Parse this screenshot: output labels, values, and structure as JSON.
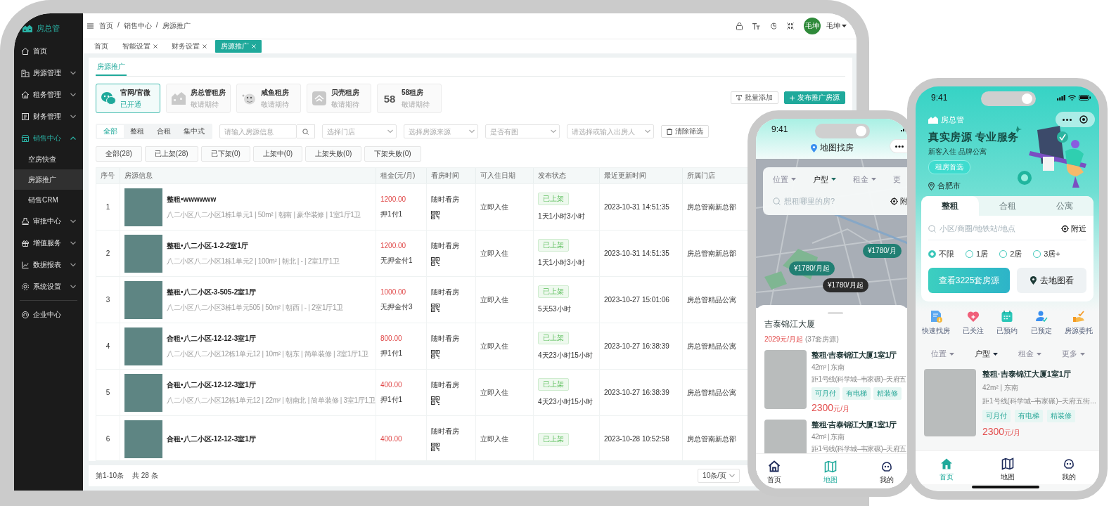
{
  "admin": {
    "logo": "房总管",
    "sidebar": {
      "items": [
        {
          "label": "首页",
          "kind": "link",
          "selected": false
        },
        {
          "label": "房源管理",
          "kind": "group",
          "expanded": false,
          "selected": false
        },
        {
          "label": "租务管理",
          "kind": "group",
          "expanded": false,
          "selected": false
        },
        {
          "label": "财务管理",
          "kind": "group",
          "expanded": false,
          "selected": false
        },
        {
          "label": "销售中心",
          "kind": "group",
          "expanded": true,
          "selected": true,
          "children": [
            {
              "label": "空房快查",
              "selected": false
            },
            {
              "label": "房源推广",
              "selected": true
            },
            {
              "label": "销售CRM",
              "selected": false
            }
          ]
        },
        {
          "label": "审批中心",
          "kind": "group",
          "expanded": false,
          "selected": false
        },
        {
          "label": "增值服务",
          "kind": "group",
          "expanded": false,
          "selected": false
        },
        {
          "label": "数据报表",
          "kind": "group",
          "expanded": false,
          "selected": false
        },
        {
          "label": "系统设置",
          "kind": "group",
          "expanded": false,
          "selected": false
        }
      ],
      "footer_items": [
        {
          "label": "企业中心",
          "selected": false
        }
      ]
    },
    "breadcrumb": [
      "首页",
      "/",
      "销售中心",
      "/",
      "房源推广"
    ],
    "user": {
      "avatar_text": "毛坤",
      "name": "毛坤"
    },
    "page_tabs": [
      {
        "label": "首页",
        "closable": false,
        "selected": false
      },
      {
        "label": "智能设置",
        "closable": true,
        "selected": false
      },
      {
        "label": "财务设置",
        "closable": true,
        "selected": false
      },
      {
        "label": "房源推广",
        "closable": true,
        "selected": true
      }
    ],
    "section_tab": {
      "label": "房源推广",
      "selected": true
    },
    "platforms": [
      {
        "name": "官网/官微",
        "status": "已开通",
        "enabled": true
      },
      {
        "name": "房总管租房",
        "status": "敬请期待",
        "enabled": false
      },
      {
        "name": "咸鱼租房",
        "status": "敬请期待",
        "enabled": false
      },
      {
        "name": "贝壳租房",
        "status": "敬请期待",
        "enabled": false
      },
      {
        "name": "58租房",
        "status": "敬请期待",
        "enabled": false,
        "logo_text": "58"
      }
    ],
    "actions": [
      {
        "label": "批量添加",
        "kind": "secondary"
      },
      {
        "label": "发布推广房源",
        "kind": "primary"
      }
    ],
    "type_filter": [
      {
        "label": "全部",
        "selected": true
      },
      {
        "label": "整租",
        "selected": false
      },
      {
        "label": "合租",
        "selected": false
      },
      {
        "label": "集中式",
        "selected": false
      }
    ],
    "search": {
      "placeholder": "请输入房源信息"
    },
    "selects": [
      {
        "placeholder": "选择门店"
      },
      {
        "placeholder": "选择房源来源"
      },
      {
        "placeholder": "是否有图"
      },
      {
        "placeholder": "请选择或输入出房人"
      }
    ],
    "clear_button": "清除筛选",
    "status_tabs": [
      "全部(28)",
      "已上架(28)",
      "已下架(0)",
      "上架中(0)",
      "上架失败(0)",
      "下架失败(0)"
    ],
    "table": {
      "columns": [
        "序号",
        "房源信息",
        "租金(元/月)",
        "看房时间",
        "可入住日期",
        "发布状态",
        "最近更新时间",
        "所属门店"
      ],
      "rows": [
        {
          "index": "1",
          "title": "整租•wwwwww",
          "details": "八二小区八二小区1栋1单元1 | 50m² | 朝南 | 豪华装修 | 1室1厅1卫",
          "rent": "1200.00",
          "payment": "押1付1",
          "viewing": "随时看房",
          "move_in": "立即入住",
          "status": "已上架",
          "duration": "1天1小时3小时",
          "updated": "2023-10-31 14:51:35",
          "store": "房总管南新总部"
        },
        {
          "index": "2",
          "title": "整租•八二小区-1-2-2室1厅",
          "details": "八二小区八二小区1栋1单元2 | 100m² | 朝北 | - | 2室1厅1卫",
          "rent": "1200.00",
          "payment": "无押金付1",
          "viewing": "随时看房",
          "move_in": "立即入住",
          "status": "已上架",
          "duration": "1天1小时3小时",
          "updated": "2023-10-31 14:51:35",
          "store": "房总管南新总部"
        },
        {
          "index": "3",
          "title": "整租•八二小区-3-505-2室1厅",
          "details": "八二小区八二小区3栋1单元505 | 50m² | 朝西 | - | 2室1厅1卫",
          "rent": "1000.00",
          "payment": "无押金付3",
          "viewing": "随时看房",
          "move_in": "立即入住",
          "status": "已上架",
          "duration": "5天53小时",
          "updated": "2023-10-27 15:01:06",
          "store": "房总管精品公寓"
        },
        {
          "index": "4",
          "title": "合租•八二小区-12-12-3室1厅",
          "details": "八二小区八二小区12栋1单元12 | 10m² | 朝东 | 简单装修 | 3室1厅1卫",
          "rent": "800.00",
          "payment": "押1付1",
          "viewing": "随时看房",
          "move_in": "立即入住",
          "status": "已上架",
          "duration": "4天23小时15小时",
          "updated": "2023-10-27 16:38:39",
          "store": "房总管精品公寓"
        },
        {
          "index": "5",
          "title": "合租•八二小区-12-12-3室1厅",
          "details": "八二小区八二小区12栋1单元12 | 22m² | 朝南北 | 简单装修 | 3室1厅1卫",
          "rent": "400.00",
          "payment": "押1付1",
          "viewing": "随时看房",
          "move_in": "立即入住",
          "status": "已上架",
          "duration": "4天23小时15小时",
          "updated": "2023-10-27 16:38:39",
          "store": "房总管精品公寓"
        },
        {
          "index": "6",
          "title": "合租•八二小区-12-12-3室1厅",
          "rent": "400.00",
          "viewing": "随时看房",
          "move_in": "立即入住",
          "status": "已上架",
          "updated": "2023-10-28 10:52:58",
          "store": "房总管南新总部"
        }
      ]
    },
    "footer": {
      "range": "第1-10条",
      "total": "共 28 条",
      "page_size": "10条/页"
    }
  },
  "map_phone": {
    "time": "9:41",
    "title": "地图找房",
    "filters": [
      {
        "label": "位置",
        "selected": false
      },
      {
        "label": "户型",
        "selected": true
      },
      {
        "label": "租金",
        "selected": false
      },
      {
        "label": "更",
        "selected": false
      }
    ],
    "search": {
      "placeholder": "想租哪里的房?"
    },
    "nearby": "附",
    "markers": [
      {
        "label": "¥1780/月起",
        "selected": false
      },
      {
        "label": "¥1780/月起",
        "selected": true
      },
      {
        "label": "¥1780/月",
        "selected": false
      }
    ],
    "building": {
      "name": "吉泰锦江大厦",
      "price": "2029元/月起",
      "count": "(37套房源)"
    },
    "listings": [
      {
        "title": "整租·吉泰锦江大厦1室1厅",
        "meta": "42m² | 东南",
        "metro": "距1号线(科学城–韦家碾)–天府五",
        "tags": [
          "可月付",
          "有电梯",
          "精装修"
        ],
        "price": "2300",
        "unit": "元/月"
      },
      {
        "title": "整租·吉泰锦江大厦1室1厅",
        "meta": "42m² | 东南",
        "metro": "距1号线(科学城–韦家碾)–天府五"
      }
    ],
    "nav": [
      {
        "label": "首页",
        "selected": false
      },
      {
        "label": "地图",
        "selected": true
      },
      {
        "label": "我的",
        "selected": false
      }
    ]
  },
  "home_phone": {
    "time": "9:41",
    "logo": "房总管",
    "headline": "真实房源 专业服务",
    "subline": "新客入住 品牌公寓",
    "badge": "租房首选",
    "city": "合肥市",
    "tabs": [
      {
        "label": "整租",
        "selected": true
      },
      {
        "label": "合租",
        "selected": false
      },
      {
        "label": "公寓",
        "selected": false
      }
    ],
    "search": {
      "placeholder": "小区/商圈/地铁站/地点"
    },
    "nearby": "附近",
    "room_options": [
      {
        "label": "不限",
        "selected": true
      },
      {
        "label": "1居",
        "selected": false
      },
      {
        "label": "2居",
        "selected": false
      },
      {
        "label": "3居+",
        "selected": false
      }
    ],
    "primary_button": "查看3225套房源",
    "map_button": "去地图看",
    "shortcuts": [
      "快速找房",
      "已关注",
      "已预约",
      "已预定",
      "房源委托"
    ],
    "filters": [
      {
        "label": "位置",
        "selected": false
      },
      {
        "label": "户型",
        "selected": true
      },
      {
        "label": "租金",
        "selected": false
      },
      {
        "label": "更多",
        "selected": false
      }
    ],
    "listing": {
      "title": "整租·吉泰锦江大厦1室1厅",
      "meta": "42m² | 东南",
      "metro": "距1号线(科学城–韦家碾)–天府五街...",
      "tags": [
        "可月付",
        "有电梯",
        "精装修"
      ],
      "price": "2300",
      "unit": "元/月"
    },
    "nav": [
      {
        "label": "首页",
        "selected": true
      },
      {
        "label": "地图",
        "selected": false
      },
      {
        "label": "我的",
        "selected": false
      }
    ]
  }
}
